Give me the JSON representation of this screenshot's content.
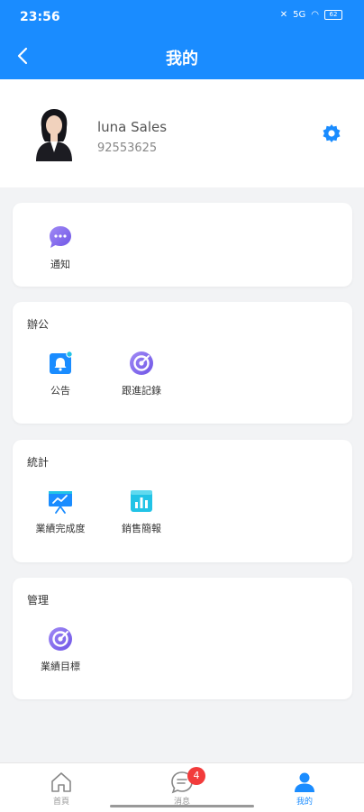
{
  "status": {
    "time": "23:56",
    "signal": "5G",
    "battery": "62"
  },
  "header": {
    "title": "我的"
  },
  "profile": {
    "name": "luna Sales",
    "phone": "92553625"
  },
  "sections": {
    "notify": {
      "items": [
        {
          "label": "通知",
          "icon": "chat-bubble-icon"
        }
      ]
    },
    "office": {
      "title": "辦公",
      "items": [
        {
          "label": "公告",
          "icon": "bell-icon"
        },
        {
          "label": "跟進記錄",
          "icon": "target-icon"
        }
      ]
    },
    "stats": {
      "title": "統計",
      "items": [
        {
          "label": "業績完成度",
          "icon": "presentation-chart-icon"
        },
        {
          "label": "銷售簡報",
          "icon": "bar-report-icon"
        }
      ]
    },
    "manage": {
      "title": "管理",
      "items": [
        {
          "label": "業績目標",
          "icon": "target-icon"
        }
      ]
    }
  },
  "bottom_nav": {
    "home": "首頁",
    "messages": "消息",
    "messages_badge": "4",
    "me": "我的"
  },
  "colors": {
    "primary": "#1a8cff",
    "purple": "#8a6cf0",
    "cyan": "#22c3e6",
    "badge": "#f23b3b"
  }
}
